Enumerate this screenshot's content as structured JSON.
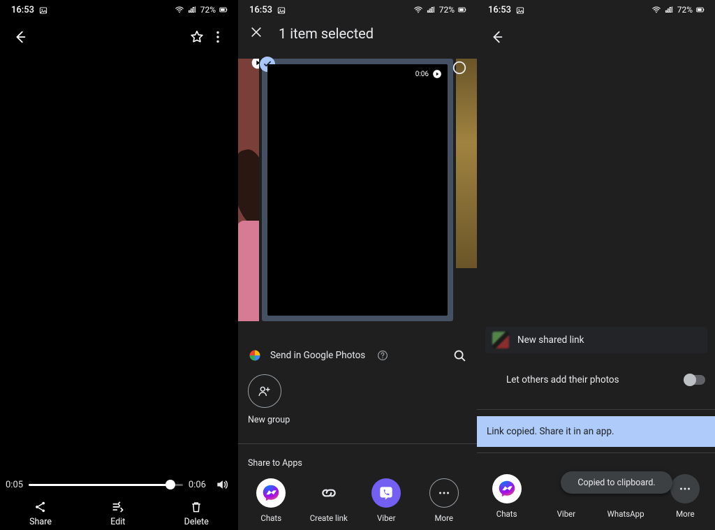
{
  "status": {
    "time": "16:53",
    "battery_pct": "72%"
  },
  "panel1": {
    "timeCurrent": "0:05",
    "timeTotal": "0:06",
    "actions": {
      "share": "Share",
      "edit": "Edit",
      "delete": "Delete"
    }
  },
  "panel2": {
    "title": "1 item selected",
    "selectedDuration": "0:06",
    "sendLabel": "Send in Google Photos",
    "newGroupLabel": "New group",
    "shareAppsTitle": "Share to Apps",
    "apps": {
      "chats": "Chats",
      "createLink": "Create link",
      "viber": "Viber",
      "more": "More"
    }
  },
  "panel3": {
    "newSharedLink": "New shared link",
    "letOthers": "Let others add their photos",
    "banner": "Link copied. Share it in an app.",
    "toast": "Copied to clipboard.",
    "apps": {
      "chats": "Chats",
      "viber": "Viber",
      "whatsapp": "WhatsApp",
      "more": "More"
    }
  }
}
